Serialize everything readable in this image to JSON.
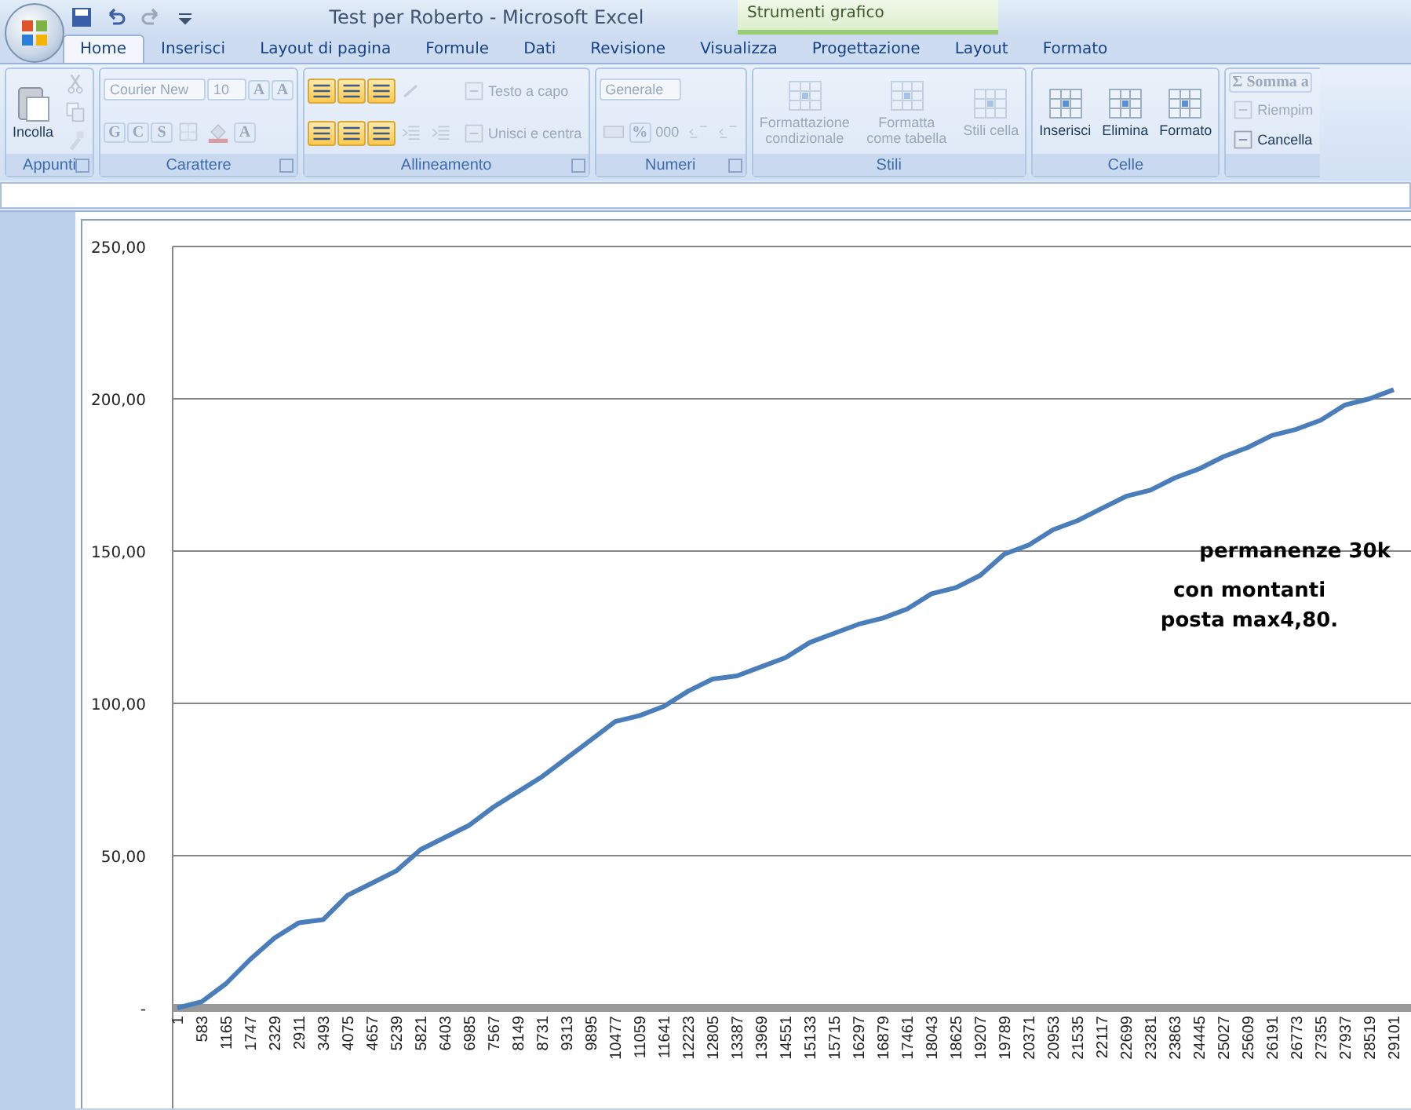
{
  "window": {
    "title": "Test per Roberto - Microsoft Excel"
  },
  "contextual_tab_group": {
    "label": "Strumenti grafico"
  },
  "tabs": [
    {
      "label": "Home",
      "selected": true
    },
    {
      "label": "Inserisci",
      "selected": false
    },
    {
      "label": "Layout di pagina",
      "selected": false
    },
    {
      "label": "Formule",
      "selected": false
    },
    {
      "label": "Dati",
      "selected": false
    },
    {
      "label": "Revisione",
      "selected": false
    },
    {
      "label": "Visualizza",
      "selected": false
    },
    {
      "label": "Progettazione",
      "selected": false
    },
    {
      "label": "Layout",
      "selected": false
    },
    {
      "label": "Formato",
      "selected": false
    }
  ],
  "ribbon_groups": [
    {
      "label": "Appunti",
      "launcher": true,
      "columns": [
        [
          [
            {
              "kind": "paste",
              "label": "Incolla",
              "disabled": false
            }
          ]
        ],
        [
          [
            {
              "kind": "cut",
              "disabled": true
            }
          ],
          [
            {
              "kind": "copy",
              "disabled": true
            }
          ],
          [
            {
              "kind": "painter",
              "disabled": true
            }
          ]
        ]
      ]
    },
    {
      "label": "Carattere",
      "launcher": true,
      "columns": [
        [
          [
            {
              "kind": "field",
              "value": "Courier New",
              "disabled": true
            },
            {
              "kind": "field",
              "value": "10",
              "disabled": true
            },
            {
              "kind": "text",
              "label": "A",
              "disabled": true
            },
            {
              "kind": "text",
              "label": "A",
              "disabled": true
            }
          ],
          [
            {
              "kind": "text",
              "label": "G",
              "disabled": true
            },
            {
              "kind": "text",
              "label": "C",
              "disabled": true
            },
            {
              "kind": "text",
              "label": "S",
              "disabled": true
            },
            {
              "kind": "borders",
              "disabled": true
            },
            {
              "kind": "fill",
              "disabled": true
            },
            {
              "kind": "text",
              "label": "A",
              "disabled": true
            }
          ]
        ]
      ]
    },
    {
      "label": "Allineamento",
      "launcher": true,
      "columns": [
        [
          [
            {
              "kind": "align",
              "selected": true,
              "disabled": false
            },
            {
              "kind": "align",
              "selected": true,
              "disabled": false
            },
            {
              "kind": "align",
              "selected": true,
              "disabled": false
            },
            {
              "kind": "orient",
              "disabled": true
            }
          ],
          [
            {
              "kind": "align",
              "selected": true,
              "disabled": false
            },
            {
              "kind": "align",
              "selected": true,
              "disabled": false
            },
            {
              "kind": "align",
              "selected": true,
              "disabled": false
            },
            {
              "kind": "indent",
              "disabled": true
            },
            {
              "kind": "indent",
              "disabled": true
            }
          ]
        ],
        [
          [
            {
              "kind": "small",
              "label": "Testo a capo",
              "disabled": true
            }
          ],
          [
            {
              "kind": "small",
              "label": "Unisci e centra",
              "disabled": true
            }
          ]
        ]
      ]
    },
    {
      "label": "Numeri",
      "launcher": true,
      "columns": [
        [
          [
            {
              "kind": "field",
              "value": "Generale",
              "disabled": true
            }
          ],
          [
            {
              "kind": "currency",
              "disabled": true
            },
            {
              "kind": "text",
              "label": "%",
              "disabled": true
            },
            {
              "kind": "text",
              "label": "000",
              "disabled": true
            },
            {
              "kind": "decimal",
              "disabled": true
            },
            {
              "kind": "decimal",
              "disabled": true
            }
          ]
        ]
      ]
    },
    {
      "label": "Stili",
      "launcher": false,
      "columns": [
        [
          [
            {
              "kind": "large",
              "label": "Formattazione condizionale",
              "disabled": true
            }
          ]
        ],
        [
          [
            {
              "kind": "large",
              "label": "Formatta come tabella",
              "disabled": true
            }
          ]
        ],
        [
          [
            {
              "kind": "large",
              "label": "Stili cella",
              "disabled": true
            }
          ]
        ]
      ]
    },
    {
      "label": "Celle",
      "launcher": false,
      "columns": [
        [
          [
            {
              "kind": "large",
              "label": "Inserisci",
              "disabled": false
            }
          ]
        ],
        [
          [
            {
              "kind": "large",
              "label": "Elimina",
              "disabled": false
            }
          ]
        ],
        [
          [
            {
              "kind": "large",
              "label": "Formato",
              "disabled": false
            }
          ]
        ]
      ]
    },
    {
      "columns": [
        [
          [
            {
              "kind": "text",
              "label": "Σ Somma a",
              "disabled": true
            }
          ],
          [
            {
              "kind": "small",
              "label": "Riempim",
              "disabled": true
            }
          ],
          [
            {
              "kind": "small",
              "label": "Cancella",
              "disabled": false
            }
          ]
        ]
      ]
    }
  ],
  "chart": {
    "chart_data": {
      "type": "line",
      "categories": [
        "1",
        "583",
        "1165",
        "1747",
        "2329",
        "2911",
        "3493",
        "4075",
        "4657",
        "5239",
        "5821",
        "6403",
        "6985",
        "7567",
        "8149",
        "8731",
        "9313",
        "9895",
        "10477",
        "11059",
        "11641",
        "12223",
        "12805",
        "13387",
        "13969",
        "14551",
        "15133",
        "15715",
        "16297",
        "16879",
        "17461",
        "18043",
        "18625",
        "19207",
        "19789",
        "20371",
        "20953",
        "21535",
        "22117",
        "22699",
        "23281",
        "23863",
        "24445",
        "25027",
        "25609",
        "26191",
        "26773",
        "27355",
        "27937",
        "28519",
        "29101"
      ],
      "grid": true,
      "series": [
        {
          "color": "#4a7ebb",
          "values": [
            0,
            2,
            8,
            16,
            23,
            28,
            29,
            37,
            41,
            45,
            52,
            56,
            60,
            66,
            71,
            76,
            82,
            88,
            94,
            96,
            99,
            104,
            108,
            109,
            112,
            115,
            120,
            123,
            126,
            128,
            131,
            136,
            138,
            142,
            149,
            152,
            157,
            160,
            164,
            168,
            170,
            174,
            177,
            181,
            184,
            188,
            190,
            193,
            198,
            200,
            203
          ]
        }
      ],
      "ylim": [
        0,
        250
      ],
      "yticks": [
        {
          "value": 0,
          "label": "-"
        },
        {
          "value": 50,
          "label": "50,00"
        },
        {
          "value": 100,
          "label": "100,00"
        },
        {
          "value": 150,
          "label": "150,00"
        },
        {
          "value": 200,
          "label": "200,00"
        },
        {
          "value": 250,
          "label": "250,00"
        }
      ],
      "annotations": [
        {
          "text": "permanenze 30k"
        },
        {
          "text": "con montanti"
        },
        {
          "text": "posta max4,80."
        }
      ]
    }
  }
}
